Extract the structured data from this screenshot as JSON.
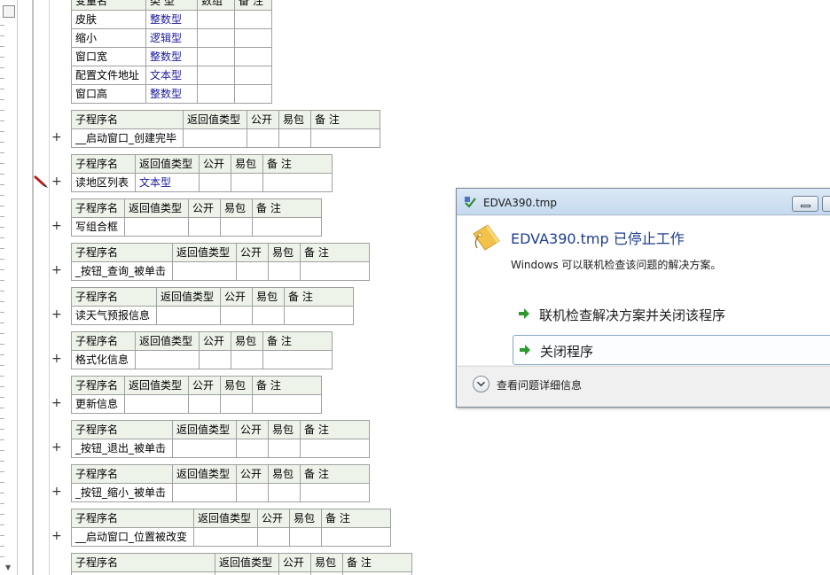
{
  "var_table": {
    "header": [
      "变量名",
      "类 型",
      "数组",
      "备 注"
    ],
    "rows": [
      {
        "name": "皮肤",
        "type": "整数型"
      },
      {
        "name": "缩小",
        "type": "逻辑型"
      },
      {
        "name": "窗口宽",
        "type": "整数型"
      },
      {
        "name": "配置文件地址",
        "type": "文本型"
      },
      {
        "name": "窗口高",
        "type": "整数型"
      }
    ]
  },
  "sub_header": {
    "name": "子程序名",
    "ret": "返回值类型",
    "public": "公开",
    "easy": "易包",
    "note": "备 注"
  },
  "subs": [
    {
      "name": "__启动窗口_创建完毕",
      "ret": ""
    },
    {
      "name": "读地区列表",
      "ret": "文本型"
    },
    {
      "name": "写组合框",
      "ret": ""
    },
    {
      "name": "_按钮_查询_被单击",
      "ret": ""
    },
    {
      "name": "读天气预报信息",
      "ret": ""
    },
    {
      "name": "格式化信息",
      "ret": ""
    },
    {
      "name": "更新信息",
      "ret": ""
    },
    {
      "name": "_按钮_退出_被单击",
      "ret": ""
    },
    {
      "name": "_按钮_缩小_被单击",
      "ret": ""
    },
    {
      "name": "__启动窗口_位置被改变",
      "ret": ""
    },
    {
      "name": "",
      "ret": ""
    }
  ],
  "plus_symbol": "+",
  "dialog": {
    "title": "EDVA390.tmp",
    "heading": "EDVA390.tmp 已停止工作",
    "subtext": "Windows 可以联机检查该问题的解决方案。",
    "option1": "联机检查解决方案并关闭该程序",
    "option2": "关闭程序",
    "details": "查看问题详细信息",
    "accent": "#1f3e8f"
  }
}
